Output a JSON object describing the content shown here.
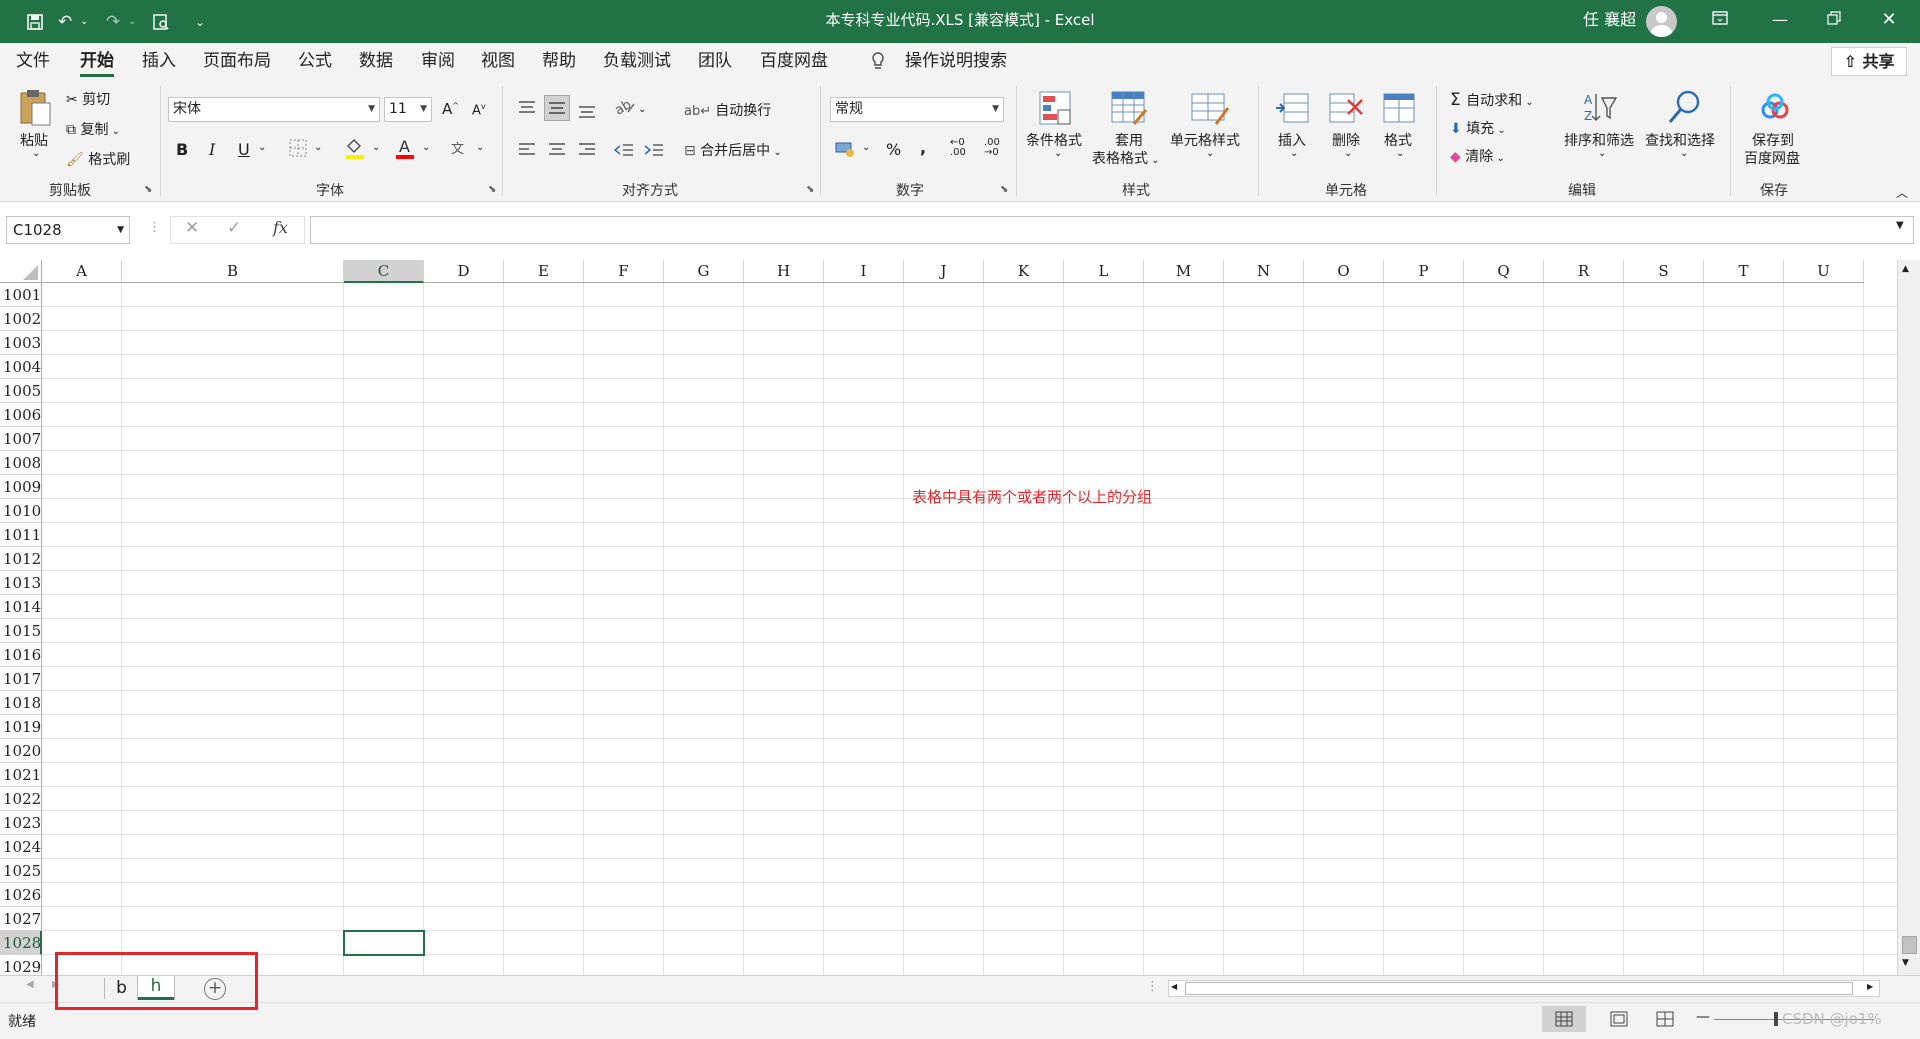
{
  "window": {
    "title": "本专科专业代码.XLS [兼容模式] - Excel",
    "user": "任 襄超",
    "accent_color": "#217346"
  },
  "ribbon_tabs": [
    "文件",
    "开始",
    "插入",
    "页面布局",
    "公式",
    "数据",
    "审阅",
    "视图",
    "帮助",
    "负载测试",
    "团队",
    "百度网盘"
  ],
  "active_tab": "开始",
  "tell_me": "操作说明搜索",
  "share_label": "共享",
  "groups": {
    "clipboard": {
      "label": "剪贴板",
      "paste": "粘贴",
      "cut": "剪切",
      "copy": "复制",
      "format_painter": "格式刷"
    },
    "font": {
      "label": "字体",
      "font_name": "宋体",
      "font_size": "11",
      "bold": "B",
      "italic": "I",
      "underline": "U"
    },
    "alignment": {
      "label": "对齐方式",
      "wrap_text": "自动换行",
      "merge_center": "合并后居中"
    },
    "number": {
      "label": "数字",
      "format": "常规"
    },
    "styles": {
      "label": "样式",
      "conditional": "条件格式",
      "table_line1": "套用",
      "table_line2": "表格格式",
      "cell_styles": "单元格样式"
    },
    "cells": {
      "label": "单元格",
      "insert": "插入",
      "delete": "删除",
      "format": "格式"
    },
    "editing": {
      "label": "编辑",
      "autosum": "自动求和",
      "fill": "填充",
      "clear": "清除",
      "sort_filter": "排序和筛选",
      "find_select": "查找和选择"
    },
    "save": {
      "label": "保存",
      "line1": "保存到",
      "line2": "百度网盘"
    }
  },
  "name_box": "C1028",
  "fx_label": "fx",
  "columns": [
    "A",
    "B",
    "C",
    "D",
    "E",
    "F",
    "G",
    "H",
    "I",
    "J",
    "K",
    "L",
    "M",
    "N",
    "O",
    "P",
    "Q",
    "R",
    "S",
    "T",
    "U"
  ],
  "selected_column": "C",
  "rows": [
    "1001",
    "1002",
    "1003",
    "1004",
    "1005",
    "1006",
    "1007",
    "1008",
    "1009",
    "1010",
    "1011",
    "1012",
    "1013",
    "1014",
    "1015",
    "1016",
    "1017",
    "1018",
    "1019",
    "1020",
    "1021",
    "1022",
    "1023",
    "1024",
    "1025",
    "1026",
    "1027",
    "1028",
    "1029"
  ],
  "selected_row": "1028",
  "annotation": "表格中具有两个或者两个以上的分组",
  "annotation_color": "#e0282e",
  "sheets": [
    "b",
    "h"
  ],
  "active_sheet": "h",
  "status": "就绪",
  "watermark": "CSDN @jo1%"
}
